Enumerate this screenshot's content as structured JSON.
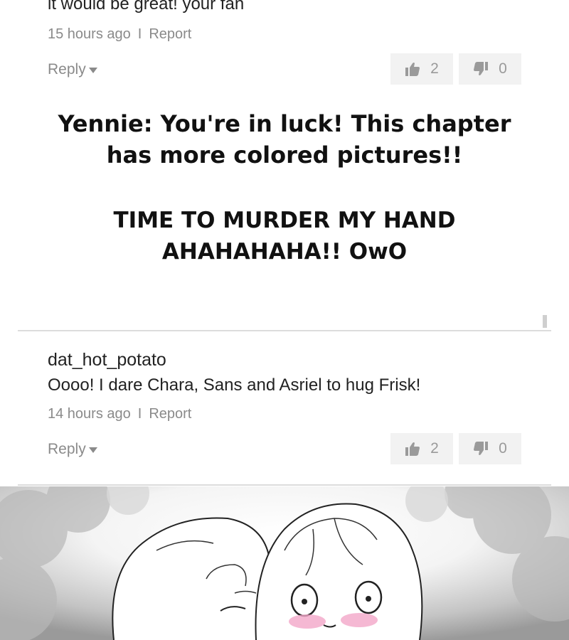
{
  "comment1": {
    "text_partial": "it would be great! your fan",
    "time": "15 hours ago",
    "separator": "I",
    "report": "Report",
    "reply": "Reply",
    "likes": "2",
    "dislikes": "0"
  },
  "author_note": {
    "line1": "Yennie: You're in luck! This chapter",
    "line2": "has more colored pictures!!",
    "line3": "TIME TO MURDER MY HAND",
    "line4": "AHAHAHAHA!! OwO"
  },
  "comment2": {
    "username": "dat_hot_potato",
    "text": "Oooo! I dare Chara, Sans and Asriel to hug Frisk!",
    "time": "14 hours ago",
    "separator": "I",
    "report": "Report",
    "reply": "Reply",
    "likes": "2",
    "dislikes": "0"
  },
  "icons": {
    "like": "thumbs-up-icon",
    "dislike": "thumbs-down-icon",
    "dropdown": "caret-down-icon"
  },
  "colors": {
    "text_dark": "#222222",
    "text_meta": "#8a8a8a",
    "vote_bg": "#f2f2f2",
    "blush": "#f2a6c8"
  }
}
